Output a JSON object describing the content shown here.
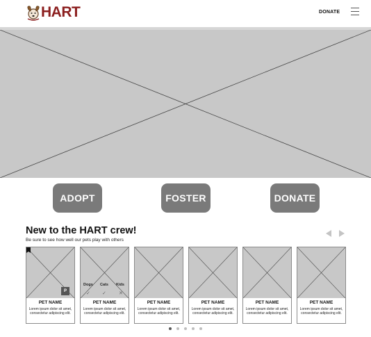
{
  "header": {
    "logo_text": "HART",
    "nav_donate": "DONATE",
    "menu_icon": "hamburger-menu-icon"
  },
  "hero": {
    "placeholder": "image-placeholder"
  },
  "actions": {
    "adopt": "ADOPT",
    "foster": "FOSTER",
    "donate": "DONATE"
  },
  "section": {
    "title": "New to the HART crew!",
    "subtitle": "Be sure to see how well our pets play with others",
    "prev_icon": "arrow-left-icon",
    "next_icon": "arrow-right-icon"
  },
  "cards": [
    {
      "name": "PET NAME",
      "desc": "Lorem ipsum dolor sit amet, consectetur adipiscing elit."
    },
    {
      "name": "PET NAME",
      "desc": "Lorem ipsum dolor sit amet, consectetur adipiscing elit."
    },
    {
      "name": "PET NAME",
      "desc": "Lorem ipsum dolor sit amet, consectetur adipiscing elit."
    },
    {
      "name": "PET NAME",
      "desc": "Lorem ipsum dolor sit amet, consectetur adipiscing elit."
    },
    {
      "name": "PET NAME",
      "desc": "Lorem ipsum dolor sit amet, consectetur adipiscing elit."
    },
    {
      "name": "PET NAME",
      "desc": "Lorem ipsum dolor sit amet, consectetur adipiscing elit."
    }
  ],
  "card1_badge": "P",
  "compat": {
    "dogs": "Dogs",
    "cats": "Cats",
    "kids": "Kids",
    "dogs_mark": "✓",
    "cats_mark": "✓",
    "kids_mark": "✕"
  },
  "pagination": {
    "total": 5,
    "active": 1
  },
  "colors": {
    "brand": "#8b1e1e",
    "button": "#7a7a7a",
    "placeholder": "#c8c8c8"
  }
}
